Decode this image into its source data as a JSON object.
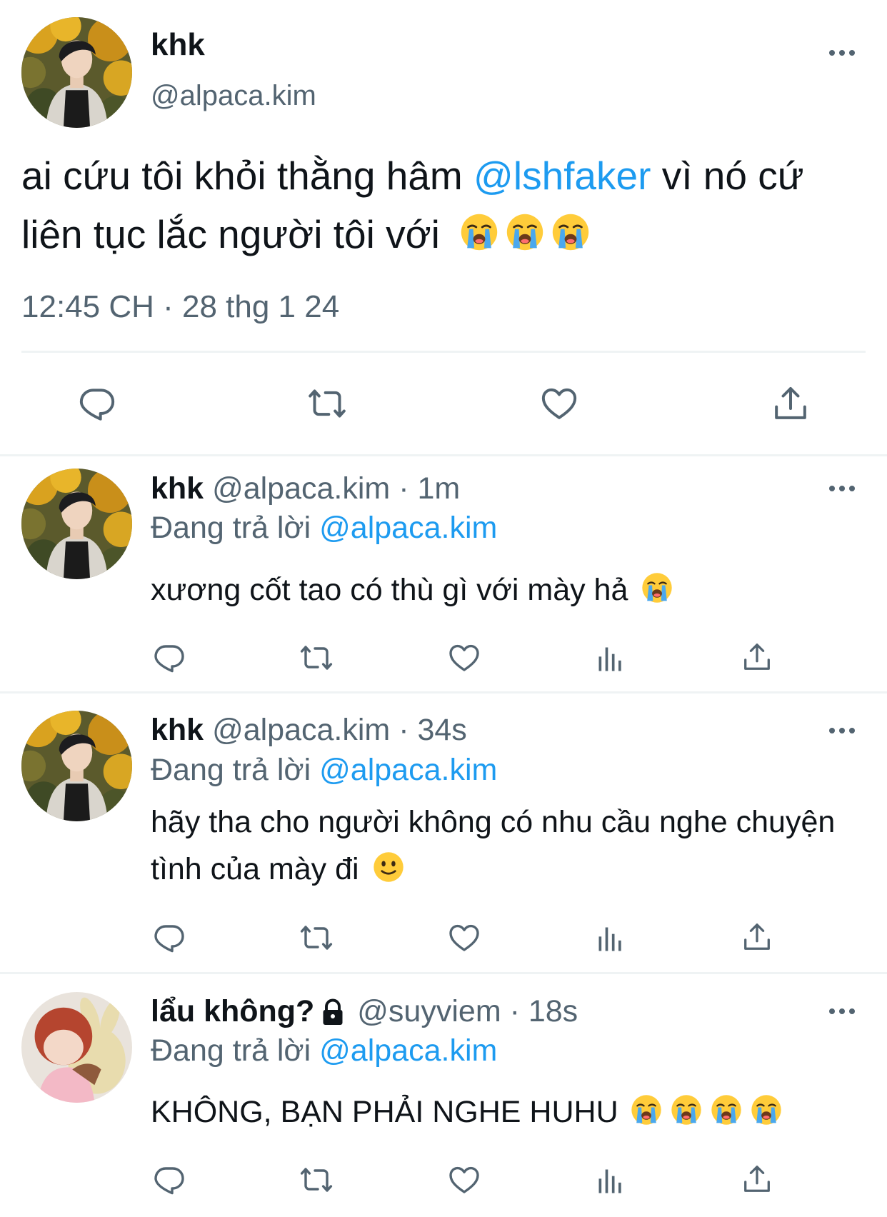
{
  "main_tweet": {
    "author_name": "khk",
    "author_handle": "@alpaca.kim",
    "text_before": "ai cứu tôi khỏi thằng hâm ",
    "mention": "@lshfaker",
    "text_after": " vì nó cứ liên tục lắc người tôi với",
    "emojis": [
      "loudly-crying-face",
      "loudly-crying-face",
      "loudly-crying-face"
    ],
    "timestamp": "12:45 CH · 28 thg 1 24"
  },
  "replies": [
    {
      "author_name": "khk",
      "handle_time": "@alpaca.kim · 1m",
      "replying_label": "Đang trả lời",
      "replying_to": "@alpaca.kim",
      "text": "xương cốt tao có thù gì với mày hả",
      "emojis": [
        "loudly-crying-face"
      ],
      "locked": false
    },
    {
      "author_name": "khk",
      "handle_time": "@alpaca.kim · 34s",
      "replying_label": "Đang trả lời",
      "replying_to": "@alpaca.kim",
      "text": "hãy tha cho người không có nhu cầu nghe chuyện tình của mày đi",
      "emojis": [
        "slightly-smiling-face"
      ],
      "locked": false
    },
    {
      "author_name": "lẩu không?",
      "handle_time": "@suyviem · 18s",
      "replying_label": "Đang trả lời",
      "replying_to": "@alpaca.kim",
      "text": "KHÔNG, BẠN PHẢI NGHE HUHU",
      "emojis": [
        "loudly-crying-face",
        "loudly-crying-face",
        "loudly-crying-face",
        "loudly-crying-face"
      ],
      "locked": true
    }
  ],
  "colors": {
    "text": "#0f1419",
    "secondary": "#536471",
    "accent": "#1d9bf0",
    "divider": "#eff3f4"
  }
}
